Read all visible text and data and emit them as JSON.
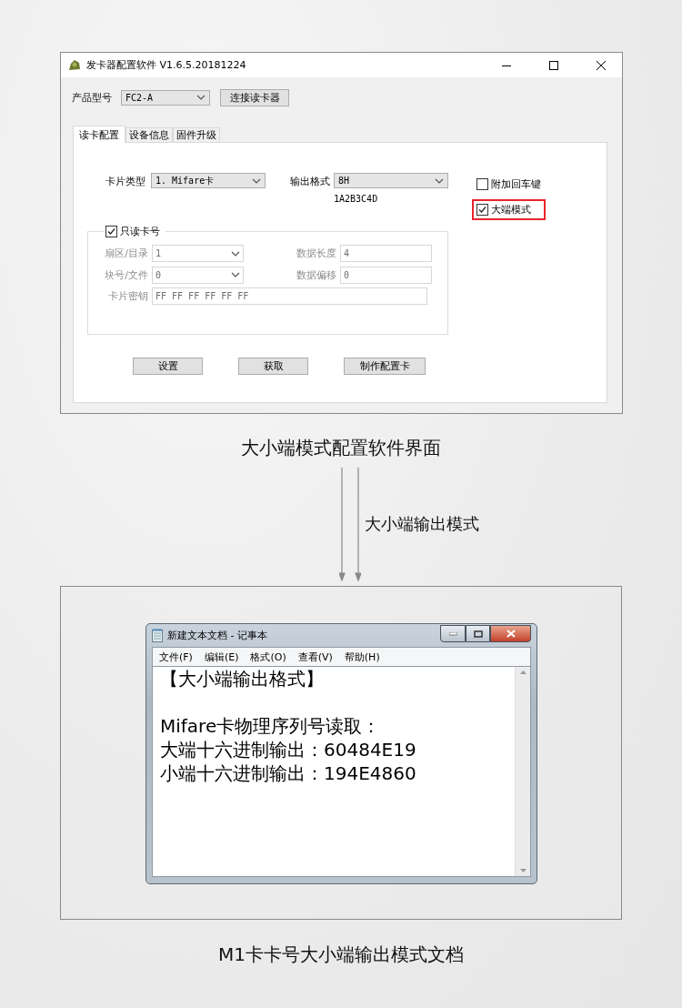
{
  "config_window": {
    "title": "发卡器配置软件 V1.6.5.20181224",
    "product": {
      "label": "产品型号",
      "value": "FC2-A"
    },
    "connect_button": "连接读卡器",
    "tabs": [
      {
        "label": "读卡配置",
        "selected": true
      },
      {
        "label": "设备信息",
        "selected": false
      },
      {
        "label": "固件升级",
        "selected": false
      }
    ],
    "card_type": {
      "label": "卡片类型",
      "value": "1. Mifare卡"
    },
    "output_format": {
      "label": "输出格式",
      "value": "8H",
      "example": "1A2B3C4D"
    },
    "options": [
      {
        "label": "附加回车键",
        "checked": false,
        "highlighted": false
      },
      {
        "label": "大端模式",
        "checked": true,
        "highlighted": true
      }
    ],
    "group": {
      "label": "只读卡号",
      "checked": true,
      "fields_left": [
        {
          "label": "扇区/目录",
          "value": "1",
          "kind": "dropdown",
          "disabled": true
        },
        {
          "label": "块号/文件",
          "value": "0",
          "kind": "dropdown",
          "disabled": true
        }
      ],
      "fields_right": [
        {
          "label": "数据长度",
          "value": "4",
          "kind": "text",
          "disabled": true
        },
        {
          "label": "数据偏移",
          "value": "0",
          "kind": "text",
          "disabled": true
        }
      ],
      "key_field": {
        "label": "卡片密钥",
        "value": "FF FF FF FF FF FF",
        "kind": "text",
        "disabled": true
      }
    },
    "buttons": [
      "设置",
      "获取",
      "制作配置卡"
    ]
  },
  "caption_top": "大小端模式配置软件界面",
  "arrow_label": "大小端输出模式",
  "notepad": {
    "title": "新建文本文档 - 记事本",
    "menu": [
      "文件(F)",
      "编辑(E)",
      "格式(O)",
      "查看(V)",
      "帮助(H)"
    ],
    "lines": [
      {
        "text": "【大小端输出格式】",
        "kind": "heading"
      },
      {
        "text": "Mifare卡物理序列号读取：",
        "kind": "line"
      },
      {
        "text": "大端十六进制输出：60484E19",
        "kind": "line"
      },
      {
        "text": "小端十六进制输出：194E4860",
        "kind": "line"
      }
    ]
  },
  "caption_bottom": "M1卡卡号大小端输出模式文档"
}
